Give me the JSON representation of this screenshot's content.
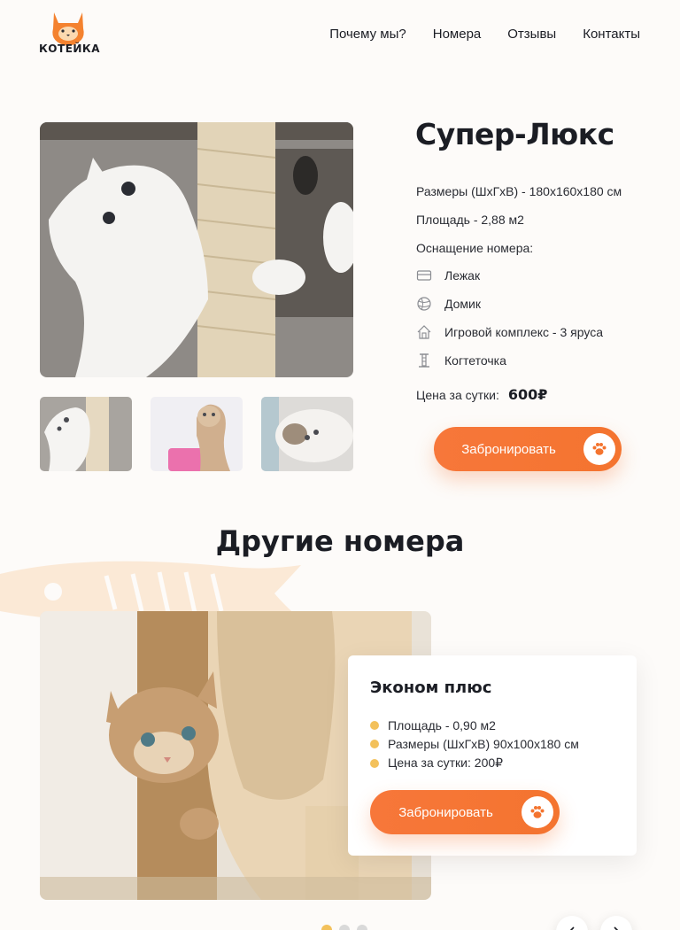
{
  "brand": {
    "name": "КОТЕЙКА"
  },
  "nav": {
    "items": [
      {
        "label": "Почему мы?"
      },
      {
        "label": "Номера"
      },
      {
        "label": "Отзывы"
      },
      {
        "label": "Контакты"
      }
    ]
  },
  "room": {
    "title": "Супер-Люкс",
    "size": "Размеры (ШхГхВ) - 180х160х180 см",
    "area": "Площадь - 2,88 м2",
    "equipment_label": "Оснащение номера:",
    "features": [
      {
        "label": "Лежак",
        "icon": "bed-icon"
      },
      {
        "label": "Домик",
        "icon": "yarn-ball-icon"
      },
      {
        "label": "Игровой комплекс - 3 яруса",
        "icon": "house-icon"
      },
      {
        "label": "Когтеточка",
        "icon": "scratching-post-icon"
      }
    ],
    "price_label": "Цена за сутки:",
    "price": "600₽",
    "book_label": "Забронировать"
  },
  "others": {
    "title": "Другие номера",
    "card": {
      "title": "Эконом плюс",
      "items": [
        "Площадь - 0,90 м2",
        "Размеры (ШхГхВ) 90х100х180 см",
        "Цена за сутки: 200₽"
      ],
      "book_label": "Забронировать"
    }
  },
  "colors": {
    "accent": "#f4742f",
    "dot": "#f3c15b",
    "text": "#1b1d24",
    "background": "#fdfbf9"
  }
}
